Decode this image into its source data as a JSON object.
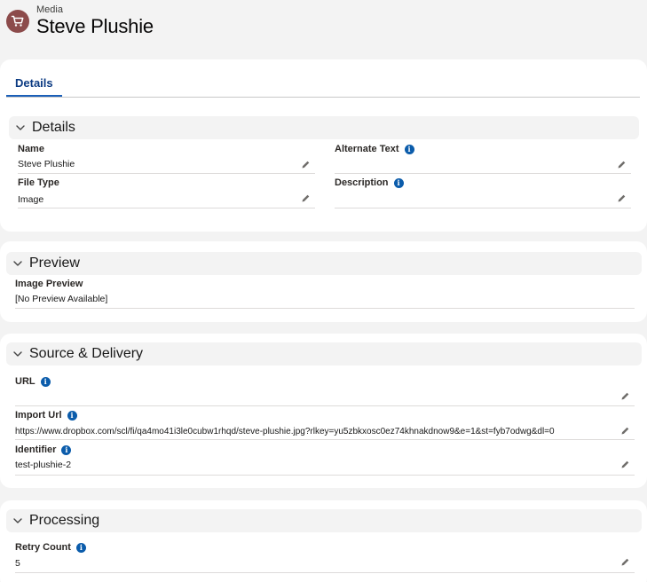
{
  "header": {
    "object_type": "Media",
    "title": "Steve Plushie",
    "icon": "cart-icon"
  },
  "tabs": [
    {
      "label": "Details",
      "active": true
    }
  ],
  "sections": {
    "details": {
      "title": "Details",
      "fields": {
        "name": {
          "label": "Name",
          "value": "Steve Plushie"
        },
        "alternate_text": {
          "label": "Alternate Text",
          "value": ""
        },
        "file_type": {
          "label": "File Type",
          "value": "Image"
        },
        "description": {
          "label": "Description",
          "value": ""
        }
      }
    },
    "preview": {
      "title": "Preview",
      "fields": {
        "image_preview": {
          "label": "Image Preview",
          "value": "[No Preview Available]"
        }
      }
    },
    "source_delivery": {
      "title": "Source & Delivery",
      "fields": {
        "url": {
          "label": "URL",
          "value": ""
        },
        "import_url": {
          "label": "Import Url",
          "value": "https://www.dropbox.com/scl/fi/qa4mo41i3le0cubw1rhqd/steve-plushie.jpg?rlkey=yu5zbkxosc0ez74khnakdnow9&e=1&st=fyb7odwg&dl=0"
        },
        "identifier": {
          "label": "Identifier",
          "value": "test-plushie-2"
        }
      }
    },
    "processing": {
      "title": "Processing",
      "fields": {
        "retry_count": {
          "label": "Retry Count",
          "value": "5"
        }
      }
    }
  },
  "colors": {
    "accent": "#0b3a82",
    "icon_bg": "#8c4b4b",
    "info": "#0b5cab",
    "page_bg": "#f3f3f3"
  }
}
